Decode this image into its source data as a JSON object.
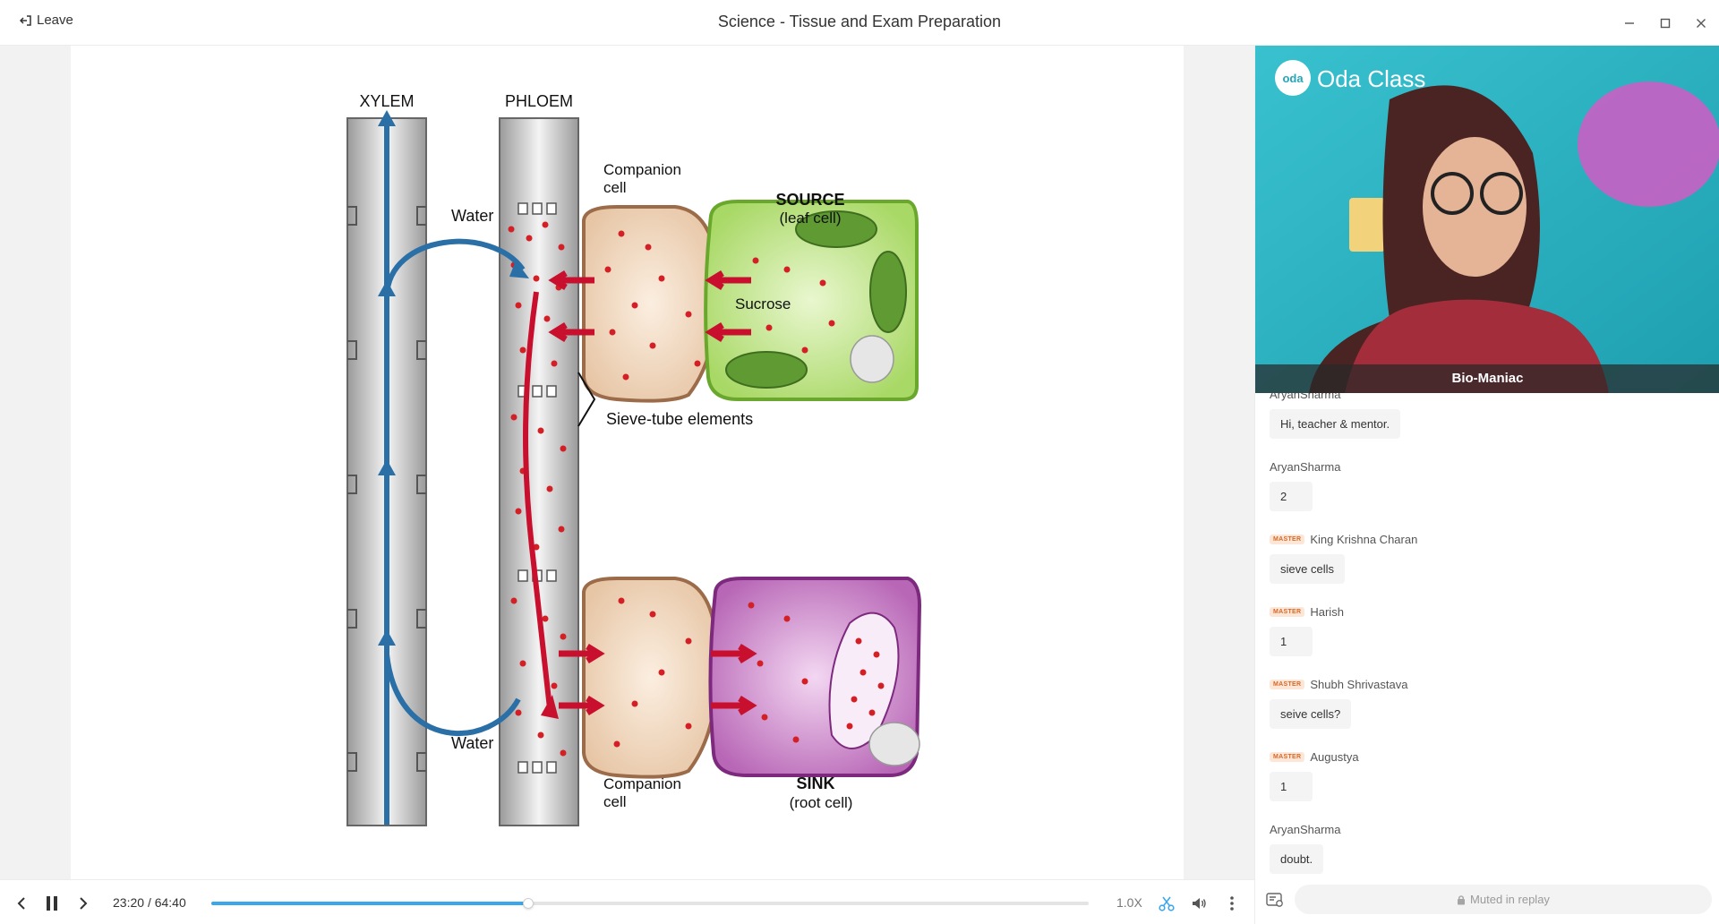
{
  "header": {
    "leave_label": "Leave",
    "title": "Science - Tissue and Exam Preparation"
  },
  "slide": {
    "labels": {
      "xylem": "XYLEM",
      "phloem": "PHLOEM",
      "companion_top_1": "Companion",
      "companion_top_2": "cell",
      "source_1": "SOURCE",
      "source_2": "(leaf cell)",
      "water_top": "Water",
      "sucrose": "Sucrose",
      "sieve_tube": "Sieve-tube elements",
      "water_bottom": "Water",
      "companion_bottom_1": "Companion",
      "companion_bottom_2": "cell",
      "sink_1": "SINK",
      "sink_2": "(root cell)"
    },
    "colors": {
      "xylem_arrow": "#2a6fa6",
      "sucrose_arrow": "#c8102e",
      "source_cell": "#b9e37f",
      "sink_cell": "#b55ab8",
      "companion_cell": "#efd0b4"
    }
  },
  "player": {
    "current_time": "23:20",
    "separator": "/",
    "duration": "64:40",
    "progress_fraction": 0.361,
    "speed": "1.0X",
    "accent_color": "#3aa6ec",
    "icons": [
      "chevron-left-icon",
      "pause-icon",
      "chevron-right-icon",
      "scissors-icon",
      "volume-icon",
      "more-vertical-icon"
    ]
  },
  "video": {
    "presenter_name": "Bio-Maniac",
    "logo_text": "Oda Class",
    "logo_mark": "oda"
  },
  "chat": {
    "partial_author": "AryanSharma",
    "messages": [
      {
        "author": "",
        "text": "Hi, teacher & mentor.",
        "master": false
      },
      {
        "author": "AryanSharma",
        "text": "2",
        "master": false
      },
      {
        "author": "King Krishna Charan",
        "text": "sieve cells",
        "master": true
      },
      {
        "author": "Harish",
        "text": "1",
        "master": true
      },
      {
        "author": "Shubh Shrivastava",
        "text": "seive cells?",
        "master": true
      },
      {
        "author": "Augustya",
        "text": "1",
        "master": true
      },
      {
        "author": "AryanSharma",
        "text": "doubt.",
        "master": false
      }
    ],
    "master_badge": "MASTER",
    "muted_label": "Muted in replay"
  }
}
